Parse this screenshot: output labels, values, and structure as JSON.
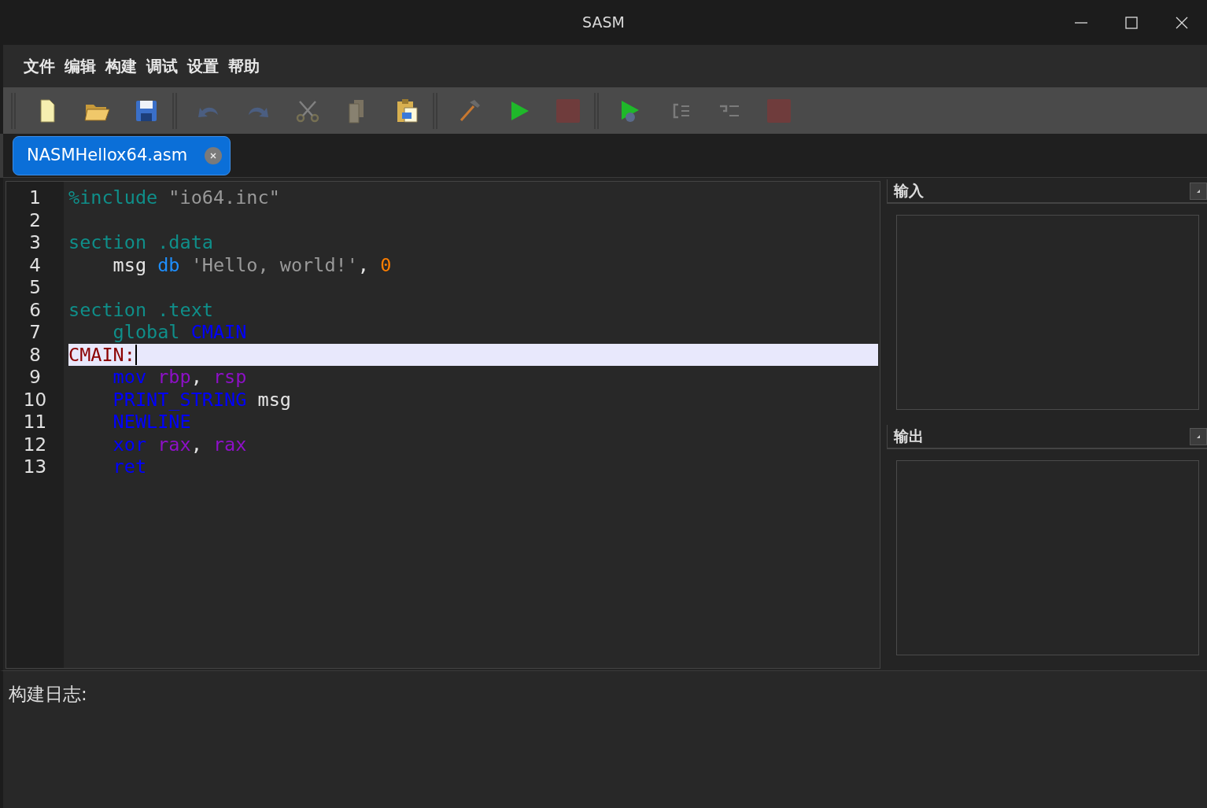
{
  "window": {
    "title": "SASM"
  },
  "menu": [
    {
      "label": "文件"
    },
    {
      "label": "编辑"
    },
    {
      "label": "构建"
    },
    {
      "label": "调试"
    },
    {
      "label": "设置"
    },
    {
      "label": "帮助"
    }
  ],
  "toolbar": [
    [
      {
        "kind": "new",
        "disabled": false
      },
      {
        "kind": "open",
        "disabled": false
      },
      {
        "kind": "save",
        "disabled": false
      }
    ],
    [
      {
        "kind": "undo",
        "disabled": true
      },
      {
        "kind": "redo",
        "disabled": true
      },
      {
        "kind": "cut",
        "disabled": true
      },
      {
        "kind": "copy",
        "disabled": true
      },
      {
        "kind": "paste",
        "disabled": false
      }
    ],
    [
      {
        "kind": "build",
        "disabled": false
      },
      {
        "kind": "run",
        "disabled": false
      },
      {
        "kind": "stop",
        "disabled": true
      }
    ],
    [
      {
        "kind": "debug",
        "disabled": false
      },
      {
        "kind": "step_into",
        "disabled": true
      },
      {
        "kind": "step_over",
        "disabled": true
      },
      {
        "kind": "stop",
        "disabled": true
      }
    ]
  ],
  "tabs": [
    {
      "label": "NASMHellox64.asm",
      "selected": true
    }
  ],
  "editor": {
    "lines": [
      {
        "number": "1",
        "current": false,
        "tokens": [
          {
            "text": "%include",
            "kind": "directive"
          },
          {
            "text": " \"io64.inc\"",
            "kind": "string"
          }
        ]
      },
      {
        "number": "2",
        "current": false
      },
      {
        "number": "3",
        "current": false,
        "tokens": [
          {
            "text": "section .data",
            "kind": "directive"
          }
        ]
      },
      {
        "number": "4",
        "current": false,
        "tokens": [
          {
            "text": "    msg ",
            "kind": "plain"
          },
          {
            "text": "db",
            "kind": "keyword"
          },
          {
            "text": " 'Hello, world!'",
            "kind": "string"
          },
          {
            "text": ", ",
            "kind": "plain"
          },
          {
            "text": "0",
            "kind": "number"
          }
        ]
      },
      {
        "number": "5",
        "current": false
      },
      {
        "number": "6",
        "current": false,
        "tokens": [
          {
            "text": "section .text",
            "kind": "directive"
          }
        ]
      },
      {
        "number": "7",
        "current": false,
        "tokens": [
          {
            "text": "    global ",
            "kind": "directive"
          },
          {
            "text": "CMAIN",
            "kind": "instruction"
          }
        ]
      },
      {
        "number": "8",
        "current": true,
        "tokens": [
          {
            "text": "CMAIN:",
            "kind": "label"
          }
        ]
      },
      {
        "number": "9",
        "current": false,
        "tokens": [
          {
            "text": "    mov ",
            "kind": "instruction"
          },
          {
            "text": "rbp",
            "kind": "register"
          },
          {
            "text": ", ",
            "kind": "plain"
          },
          {
            "text": "rsp",
            "kind": "register"
          }
        ]
      },
      {
        "number": "10",
        "current": false,
        "tokens": [
          {
            "text": "    PRINT_STRING",
            "kind": "instruction"
          },
          {
            "text": " msg",
            "kind": "plain"
          }
        ]
      },
      {
        "number": "11",
        "current": false,
        "tokens": [
          {
            "text": "    NEWLINE",
            "kind": "instruction"
          }
        ]
      },
      {
        "number": "12",
        "current": false,
        "tokens": [
          {
            "text": "    xor ",
            "kind": "instruction"
          },
          {
            "text": "rax",
            "kind": "register"
          },
          {
            "text": ", ",
            "kind": "plain"
          },
          {
            "text": "rax",
            "kind": "register"
          }
        ]
      },
      {
        "number": "13",
        "current": false,
        "tokens": [
          {
            "text": "    ret",
            "kind": "instruction"
          }
        ]
      }
    ]
  },
  "panels": [
    {
      "title": "输入"
    },
    {
      "title": "输出"
    }
  ],
  "build_log": {
    "label": "构建日志:"
  }
}
